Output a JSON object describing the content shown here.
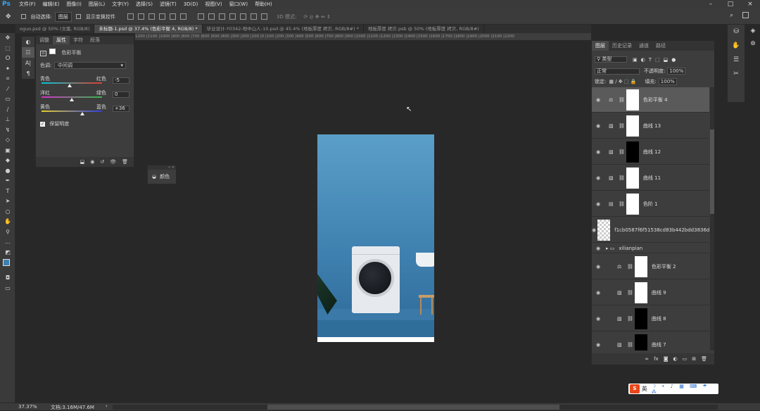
{
  "app": {
    "logo": "Ps"
  },
  "menu": [
    "文件(F)",
    "编辑(E)",
    "图像(I)",
    "图层(L)",
    "文字(Y)",
    "选择(S)",
    "滤镜(T)",
    "3D(D)",
    "视图(V)",
    "窗口(W)",
    "帮助(H)"
  ],
  "options": {
    "auto_select_label": "自动选择:",
    "auto_select_value": "图层",
    "show_transform_label": "显示变换控件",
    "mode3d": "3D 模式:"
  },
  "tabs": [
    "oguo.psd @ 50% (文案, RGB/8)",
    "未标题-1.psd @ 37.4% (色彩平衡 4, RGB/8) *",
    "毕业设计-Y0342-地中山人-10.psd @ 45.4% (地板厚度 拷贝, RGB/8#) *",
    "地板厚度 拷贝.psb @ 50% (地板厚度 拷贝, RGB/8#)"
  ],
  "ruler": "1200 |1100 |1000 |900 |800 |700 |600 |500 |400 |300 |200 |100 |0 |100 |200 |300 |400 |500 |600 |700 |800 |900 |1000 |1100 |1200 |1300 |1400 |1500 |1600 |1700 |1800 |1900 |2000 |2100 |2200",
  "properties": {
    "tabs": [
      "调整",
      "属性",
      "字符",
      "段落"
    ],
    "title": "色彩平衡",
    "tone_label": "色调:",
    "tone_value": "中间调",
    "sliders": [
      {
        "left": "青色",
        "right": "红色",
        "value": "-5",
        "pos": 0.47
      },
      {
        "left": "洋红",
        "right": "绿色",
        "value": "0",
        "pos": 0.5
      },
      {
        "left": "黄色",
        "right": "蓝色",
        "value": "+36",
        "pos": 0.68
      }
    ],
    "preserve": "保留明度"
  },
  "color_panel": {
    "label": "颜色"
  },
  "layers": {
    "tabs": [
      "图层",
      "历史记录",
      "通道",
      "路径"
    ],
    "filter": "类型",
    "blend": "正常",
    "opacity_label": "不透明度:",
    "opacity": "100%",
    "lock_label": "锁定:",
    "fill_label": "填充:",
    "fill": "100%",
    "items": [
      {
        "name": "色彩平衡 4",
        "mask": "white",
        "selected": true
      },
      {
        "name": "曲线 13",
        "mask": "white"
      },
      {
        "name": "曲线 12",
        "mask": "black"
      },
      {
        "name": "曲线 11",
        "mask": "white"
      },
      {
        "name": "色阶 1",
        "mask": "white"
      },
      {
        "name": "f1cb0587f6f51538cd83b442bdd3836d...",
        "mask": "checker"
      },
      {
        "name": "xilianpian",
        "mask": "group"
      },
      {
        "name": "色彩平衡 2",
        "mask": "white"
      },
      {
        "name": "曲线 9",
        "mask": "white"
      },
      {
        "name": "曲线 8",
        "mask": "black"
      },
      {
        "name": "曲线 7",
        "mask": "black"
      }
    ]
  },
  "status": {
    "zoom": "37.37%",
    "doc": "文档:3.16M/47.6M"
  },
  "ime": {
    "label": "英"
  }
}
